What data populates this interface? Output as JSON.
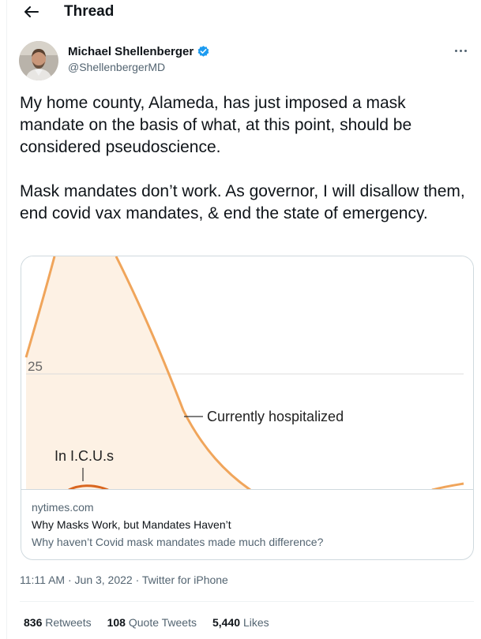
{
  "header": {
    "title": "Thread"
  },
  "author": {
    "name": "Michael Shellenberger",
    "handle": "@ShellenbergerMD"
  },
  "tweet": {
    "text": "My home county, Alameda, has just imposed a mask mandate on the basis of what, at this point, should be considered pseudoscience.\n\nMask mandates don’t work. As governor, I will disallow them, end covid vax mandates, & end the state of emergency."
  },
  "card": {
    "chart_labels": {
      "tick": "25",
      "hospitalized": "Currently hospitalized",
      "icu": "In I.C.U.s"
    },
    "domain": "nytimes.com",
    "title": "Why Masks Work, but Mandates Haven’t",
    "description": "Why haven’t Covid mask mandates made much difference?"
  },
  "meta": {
    "time": "11:11 AM",
    "date": "Jun 3, 2022",
    "source": "Twitter for iPhone"
  },
  "stats": {
    "retweets_count": "836",
    "retweets_label": "Retweets",
    "quotes_count": "108",
    "quotes_label": "Quote Tweets",
    "likes_count": "5,440",
    "likes_label": "Likes"
  },
  "colors": {
    "accent": "#1d9bf0",
    "chart_line": "#f0a55b",
    "chart_fill": "#fdf1e4",
    "icu_line": "#d9661f",
    "muted_text": "#536471"
  }
}
